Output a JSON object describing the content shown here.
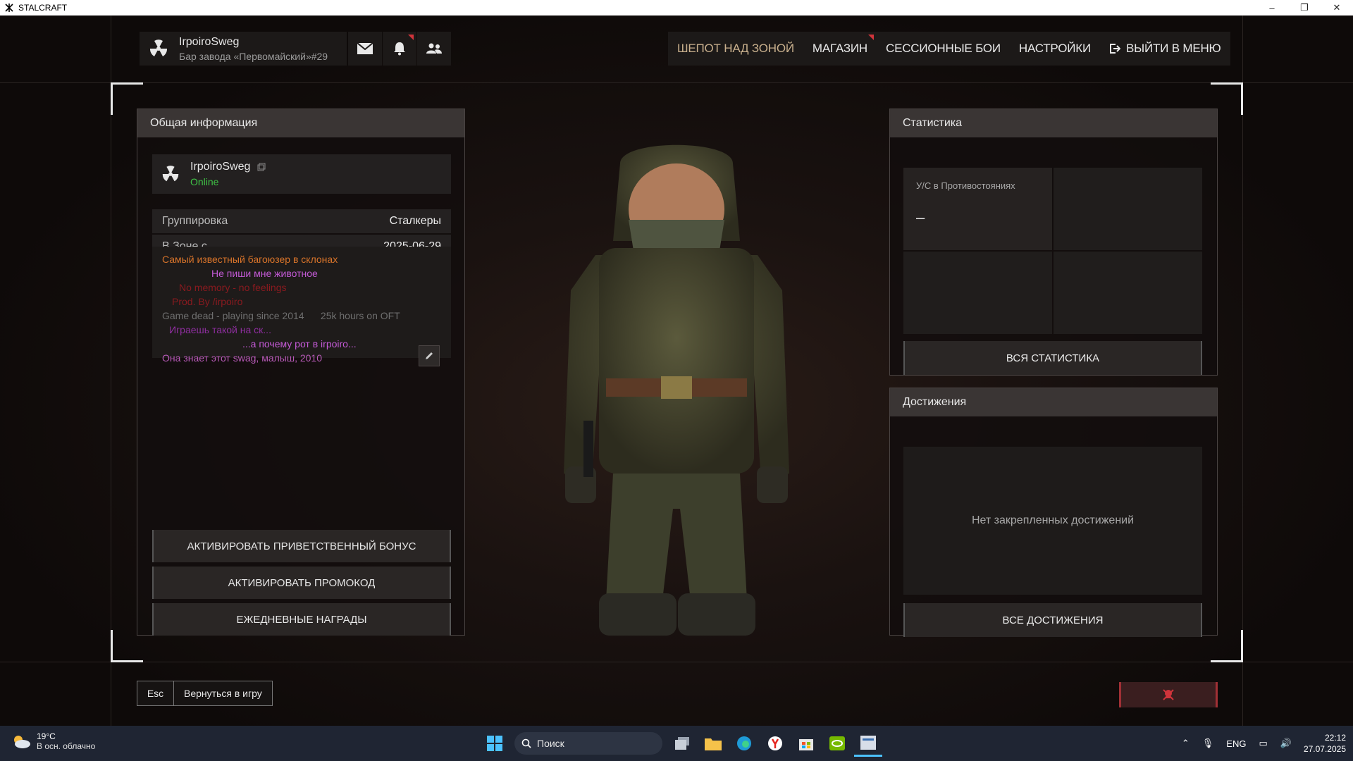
{
  "window": {
    "title": "STALCRAFT",
    "minimize": "–",
    "restore": "❐",
    "close": "✕"
  },
  "header": {
    "player_name": "IrpoiroSweg",
    "player_location": "Бар завода «Первомайский»#29",
    "nav": [
      {
        "label": "ШЕПОТ НАД ЗОНОЙ"
      },
      {
        "label": "МАГАЗИН"
      },
      {
        "label": "СЕССИОННЫЕ БОИ"
      },
      {
        "label": "НАСТРОЙКИ"
      },
      {
        "label": "ВЫЙТИ В МЕНЮ"
      }
    ]
  },
  "general": {
    "title": "Общая информация",
    "name": "IrpoiroSweg",
    "status": "Online",
    "faction_label": "Группировка",
    "faction_value": "Сталкеры",
    "since_label": "В Зоне с",
    "since_value": "2025-06-29",
    "bio": [
      {
        "text": "Самый известный багоюзер в склонах",
        "color": "#d9742a"
      },
      {
        "text": "Не пиши мне животное",
        "color": "#c35ad6"
      },
      {
        "text": "No memory - no feelings",
        "color": "#8a1a1f"
      },
      {
        "text": "Prod. By /irpoiro",
        "color": "#8a1a1f"
      },
      {
        "text": "Game dead - playing since 2014      25k hours on OFT",
        "color": "#6e6e6e"
      },
      {
        "text": "Играешь такой на ск...",
        "color": "#8f2ea0"
      },
      {
        "text": "...а почему рот в irpoiro...",
        "color": "#c35ad6"
      },
      {
        "text": "Она знает этот swag, малыш, 2010",
        "color": "#b85ab8"
      }
    ],
    "buttons": {
      "welcome": "АКТИВИРОВАТЬ ПРИВЕТСТВЕННЫЙ БОНУС",
      "promo": "АКТИВИРОВАТЬ ПРОМОКОД",
      "daily": "ЕЖЕДНЕВНЫЕ НАГРАДЫ"
    }
  },
  "stats": {
    "title": "Статистика",
    "kd_label": "У/С в Противостояниях",
    "kd_value": "–",
    "all_button": "ВСЯ СТАТИСТИКА"
  },
  "achievements": {
    "title": "Достижения",
    "empty": "Нет закрепленных достижений",
    "all_button": "ВСЕ ДОСТИЖЕНИЯ"
  },
  "footer": {
    "esc_key": "Esc",
    "esc_label": "Вернуться в игру"
  },
  "taskbar": {
    "temp": "19°C",
    "weather": "В осн. облачно",
    "search": "Поиск",
    "lang": "ENG",
    "time": "22:12",
    "date": "27.07.2025"
  },
  "colors": {
    "accent_nav": "#c9b08d",
    "online": "#3fc246",
    "notify": "#d0343b"
  }
}
